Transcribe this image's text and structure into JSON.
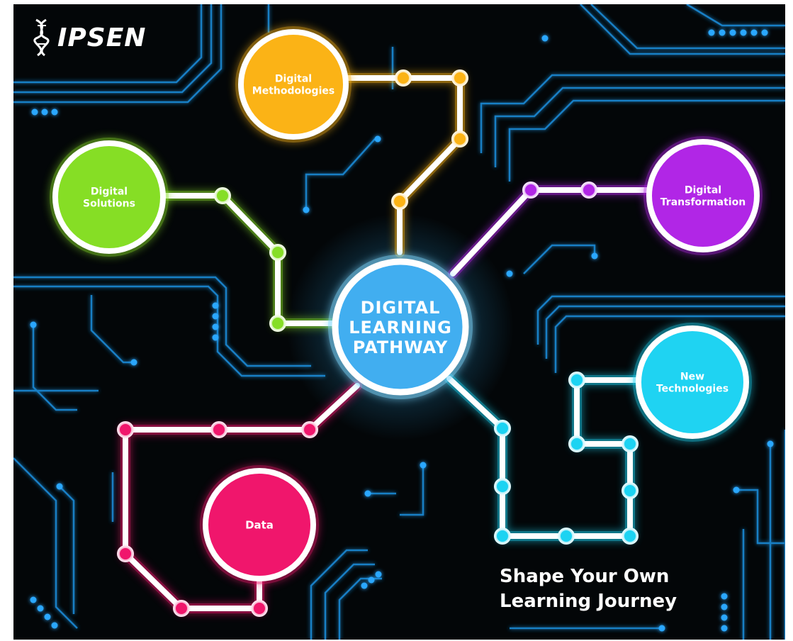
{
  "brand": {
    "logo_text": "IPSEN"
  },
  "center": {
    "lines": [
      "DIGITAL",
      "LEARNING",
      "PATHWAY"
    ],
    "color": "#41aef0"
  },
  "nodes": [
    {
      "id": "methodologies",
      "lines": [
        "Digital",
        "Methodologies"
      ],
      "color": "#fbb316"
    },
    {
      "id": "solutions",
      "lines": [
        "Digital",
        "Solutions"
      ],
      "color": "#86de25"
    },
    {
      "id": "transformation",
      "lines": [
        "Digital",
        "Transformation"
      ],
      "color": "#b126e6"
    },
    {
      "id": "technologies",
      "lines": [
        "New",
        "Technologies"
      ],
      "color": "#1fd3f2"
    },
    {
      "id": "data",
      "lines": [
        "Data"
      ],
      "color": "#f0166c"
    }
  ],
  "tagline": {
    "line1": "Shape Your Own",
    "line2": "Learning Journey"
  },
  "colors": {
    "background": "#030608",
    "circuit": "#1d95e6",
    "path_stroke": "#ffffff"
  }
}
